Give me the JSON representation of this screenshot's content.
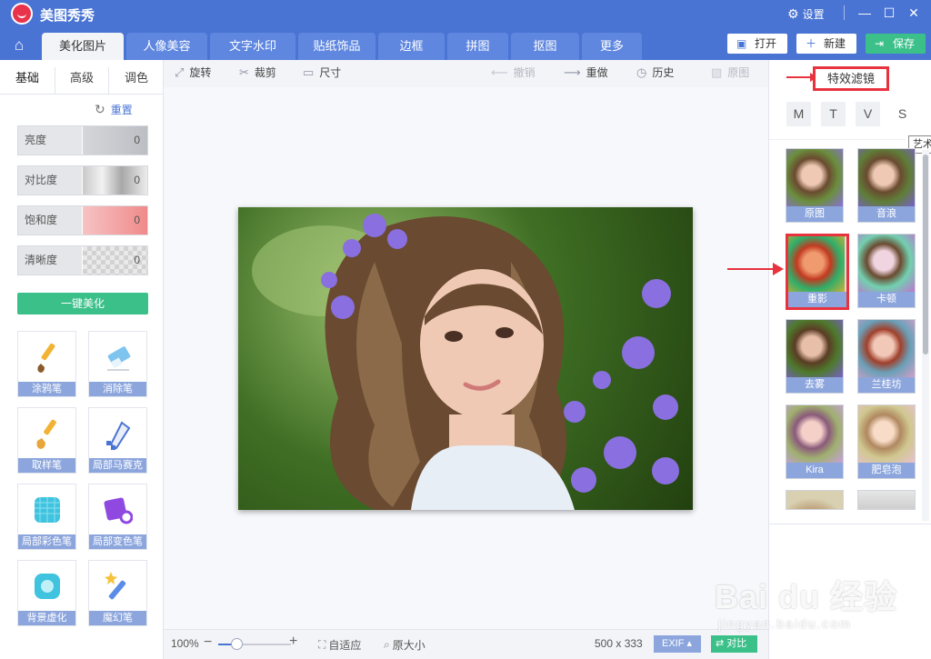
{
  "app": {
    "title": "美图秀秀",
    "settings_label": "设置"
  },
  "colors": {
    "brand_blue": "#4a74d4",
    "accent_green": "#3cc08a",
    "highlight_red": "#e8333e",
    "caption_blue": "#8ca6dd"
  },
  "nav_tabs": [
    "美化图片",
    "人像美容",
    "文字水印",
    "贴纸饰品",
    "边框",
    "拼图",
    "抠图",
    "更多"
  ],
  "top_buttons": {
    "open": "打开",
    "new": "新建",
    "save": "保存"
  },
  "left_panel": {
    "subtabs": [
      "基础",
      "高级",
      "调色"
    ],
    "reset_label": "重置",
    "sliders": [
      {
        "label": "亮度",
        "value": "0"
      },
      {
        "label": "对比度",
        "value": "0"
      },
      {
        "label": "饱和度",
        "value": "0"
      },
      {
        "label": "清晰度",
        "value": "0"
      }
    ],
    "auto_beautify": "一键美化",
    "tools": [
      "涂鸦笔",
      "消除笔",
      "取样笔",
      "局部马赛克",
      "局部彩色笔",
      "局部变色笔",
      "背景虚化",
      "魔幻笔"
    ]
  },
  "canvas_toolbar": {
    "rotate": "旋转",
    "crop": "裁剪",
    "size": "尺寸",
    "undo": "撤销",
    "redo": "重做",
    "history": "历史",
    "original": "原图"
  },
  "bottom_bar": {
    "zoom": "100%",
    "zoom_level": 0.25,
    "fit": "自适应",
    "actual_size": "原大小",
    "dimensions": "500 x 333",
    "exif": "EXIF",
    "compare": "对比"
  },
  "right_panel": {
    "title": "特效滤镜",
    "letters": [
      "M",
      "T",
      "V",
      "S"
    ],
    "tooltip": "艺术",
    "filters": [
      "原图",
      "音浪",
      "重影",
      "卡顿",
      "去雾",
      "兰桂坊",
      "Kira",
      "肥皂泡"
    ]
  },
  "watermark": {
    "brand": "Bai du 经验",
    "url": "jingyan.baidu.com"
  }
}
